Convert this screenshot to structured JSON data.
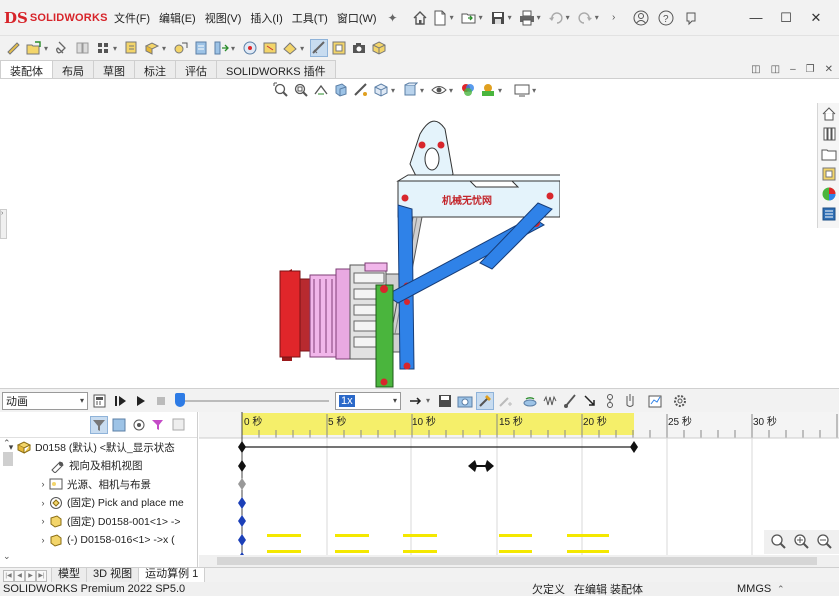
{
  "app": {
    "logo_mark": "DS",
    "logo_text": "SOLIDWORKS"
  },
  "menus": [
    "文件(F)",
    "编辑(E)",
    "视图(V)",
    "插入(I)",
    "工具(T)",
    "窗口(W)"
  ],
  "quick_icons": [
    "home-icon",
    "new-file-icon",
    "open-icon",
    "save-icon",
    "print-icon",
    "undo-icon",
    "redo-icon",
    "arrow-icon",
    "user-icon",
    "help-icon",
    "notifications-icon"
  ],
  "window_controls": {
    "minimize": "—",
    "maximize": "☐",
    "close": "✕"
  },
  "command_tabs": [
    "装配体",
    "布局",
    "草图",
    "标注",
    "评估",
    "SOLIDWORKS 插件"
  ],
  "command_tabs_active": 0,
  "graphics": {
    "plate_text": "机械无忧网",
    "colors": {
      "frame": "#e4f3fb",
      "link": "#2f82e8",
      "vertical_link": "#4ab53d",
      "red_pad": "#e0262a",
      "gripper": "#f1b6ea",
      "joint": "#d8262c"
    }
  },
  "motion": {
    "study_type": "动画",
    "speed": "1x",
    "ruler_labels": [
      "0 秒",
      "5 秒",
      "10 秒",
      "15 秒",
      "20 秒",
      "25 秒",
      "30 秒"
    ],
    "tree": [
      {
        "expand": "▾",
        "icon": "assembly-icon",
        "label": "D0158 (默认) <默认_显示状态"
      },
      {
        "expand": "",
        "icon": "camera-view-icon",
        "label": "视向及相机视图"
      },
      {
        "expand": "›",
        "icon": "lights-icon",
        "label": "光源、相机与布景"
      },
      {
        "expand": "›",
        "icon": "subassembly-icon",
        "label": "(固定) Pick and place me"
      },
      {
        "expand": "›",
        "icon": "part-icon",
        "label": "(固定) D0158-001<1> ->"
      },
      {
        "expand": "›",
        "icon": "part-icon",
        "label": "(-) D0158-016<1> ->x ("
      }
    ]
  },
  "bottom_tabs": [
    "模型",
    "3D 视图",
    "运动算例 1"
  ],
  "bottom_tabs_active": 2,
  "status": {
    "app": "SOLIDWORKS Premium 2022 SP5.0",
    "definition": "欠定义",
    "editing": "在编辑 装配体",
    "units": "MMGS"
  }
}
